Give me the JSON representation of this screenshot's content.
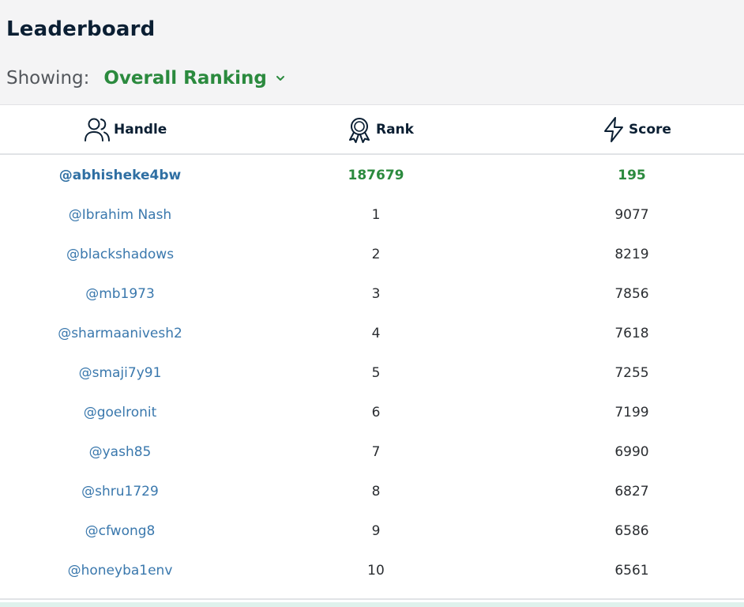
{
  "header": {
    "title": "Leaderboard",
    "showing_label": "Showing:",
    "selected_view": "Overall Ranking"
  },
  "columns": {
    "handle": "Handle",
    "rank": "Rank",
    "score": "Score"
  },
  "current_user": {
    "handle": "@abhisheke4bw",
    "rank": "187679",
    "score": "195"
  },
  "rows": [
    {
      "handle": "@Ibrahim Nash",
      "rank": "1",
      "score": "9077"
    },
    {
      "handle": "@blackshadows",
      "rank": "2",
      "score": "8219"
    },
    {
      "handle": "@mb1973",
      "rank": "3",
      "score": "7856"
    },
    {
      "handle": "@sharmaanivesh2",
      "rank": "4",
      "score": "7618"
    },
    {
      "handle": "@smaji7y91",
      "rank": "5",
      "score": "7255"
    },
    {
      "handle": "@goelronit",
      "rank": "6",
      "score": "7199"
    },
    {
      "handle": "@yash85",
      "rank": "7",
      "score": "6990"
    },
    {
      "handle": "@shru1729",
      "rank": "8",
      "score": "6827"
    },
    {
      "handle": "@cfwong8",
      "rank": "9",
      "score": "6586"
    },
    {
      "handle": "@honeyba1env",
      "rank": "10",
      "score": "6561"
    }
  ],
  "colors": {
    "accent_green": "#2b8a3e",
    "handle_blue": "#3a78ad",
    "title_dark": "#0b1f33"
  },
  "icons": {
    "handle": "users-icon",
    "rank": "award-icon",
    "score": "lightning-icon",
    "dropdown": "chevron-down-icon"
  }
}
